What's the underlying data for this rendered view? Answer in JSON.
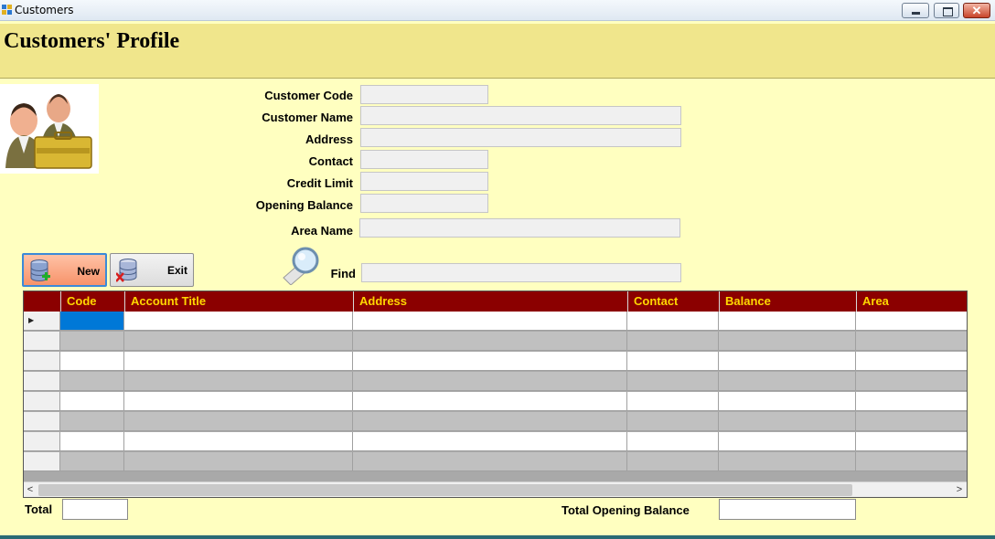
{
  "window": {
    "title": "Customers"
  },
  "header": {
    "title": "Customers' Profile"
  },
  "form": {
    "customer_code": {
      "label": "Customer Code",
      "value": ""
    },
    "customer_name": {
      "label": "Customer Name",
      "value": ""
    },
    "address": {
      "label": "Address",
      "value": ""
    },
    "contact": {
      "label": "Contact",
      "value": ""
    },
    "credit_limit": {
      "label": "Credit Limit",
      "value": ""
    },
    "opening_balance": {
      "label": "Opening Balance",
      "value": ""
    },
    "area_name": {
      "label": "Area Name",
      "value": ""
    }
  },
  "toolbar": {
    "new_label": "New",
    "exit_label": "Exit"
  },
  "find": {
    "label": "Find",
    "value": ""
  },
  "grid": {
    "columns": [
      "Code",
      "Account Title",
      "Address",
      "Contact",
      "Balance",
      "Area"
    ],
    "header_bg": "#8b0000",
    "header_fg": "#ffd700",
    "row_count": 8
  },
  "footer": {
    "total_label": "Total",
    "total_value": "",
    "total_opening_label": "Total Opening Balance",
    "total_opening_value": ""
  },
  "colors": {
    "background": "#ffffc0",
    "banner": "#f0e68c",
    "selected_cell": "#0078d7"
  }
}
